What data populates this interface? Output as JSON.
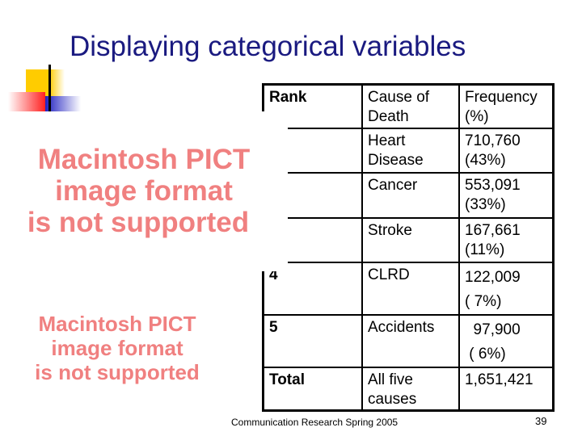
{
  "slide": {
    "title": "Displaying categorical variables",
    "footer": "Communication Research Spring 2005",
    "page_number": "39"
  },
  "table": {
    "headers": [
      "Rank",
      "Cause of Death",
      "Frequency (%)"
    ],
    "rows": [
      {
        "rank": "",
        "cause": "Heart Disease",
        "freq": "710,760",
        "pct": "(43%)"
      },
      {
        "rank": "",
        "cause": "Cancer",
        "freq": "553,091",
        "pct": "(33%)"
      },
      {
        "rank": "",
        "cause": "Stroke",
        "freq": "167,661",
        "pct": "(11%)"
      },
      {
        "rank": "4",
        "cause": "CLRD",
        "freq": "122,009",
        "pct": "( 7%)"
      },
      {
        "rank": "5",
        "cause": "Accidents",
        "freq": "  97,900",
        "pct": " ( 6%)"
      },
      {
        "rank": "Total",
        "cause": "All five causes",
        "freq": "1,651,421",
        "pct": ""
      }
    ]
  },
  "placeholders": [
    {
      "line1": "Macintosh PICT",
      "line2": "image format",
      "line3": "is not supported"
    },
    {
      "line1": "Macintosh PICT",
      "line2": "image format",
      "line3": "is not supported"
    }
  ],
  "colors": {
    "title": "#1a1a80",
    "placeholder_text": "#f08080",
    "deco_yellow": "#ffcc00",
    "deco_red": "#ff2020",
    "deco_blue": "#2020c0"
  }
}
